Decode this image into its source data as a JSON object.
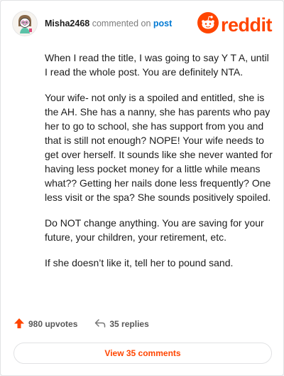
{
  "comment": {
    "username": "Misha2468",
    "action_text": "commented on",
    "post_link": "post",
    "paragraphs": [
      "When I read the title, I was going to say Y T A, until I read the whole post. You are definitely NTA.",
      "Your wife- not only is a spoiled and entitled, she is the AH. She has a nanny, she has parents who pay her to go to school, she has support from you and that is still not enough? NOPE! Your wife needs to get over herself. It sounds like she never wanted for having less pocket money for a little while means what?? Getting her nails done less frequently? One less visit or the spa? She sounds positively spoiled.",
      "Do NOT change anything. You are saving for your future, your children, your retirement, etc.",
      "If she doesn’t like it, tell her to pound sand."
    ],
    "upvotes": "980 upvotes",
    "replies": "35 replies",
    "view_comments": "View 35 comments"
  },
  "brand": {
    "wordmark": "reddit",
    "color": "#ff4500"
  },
  "icons": {
    "avatar": "snoo-avatar",
    "logo": "reddit-snoo-icon",
    "upvote": "upvote-arrow-icon",
    "reply": "reply-arrow-icon"
  }
}
